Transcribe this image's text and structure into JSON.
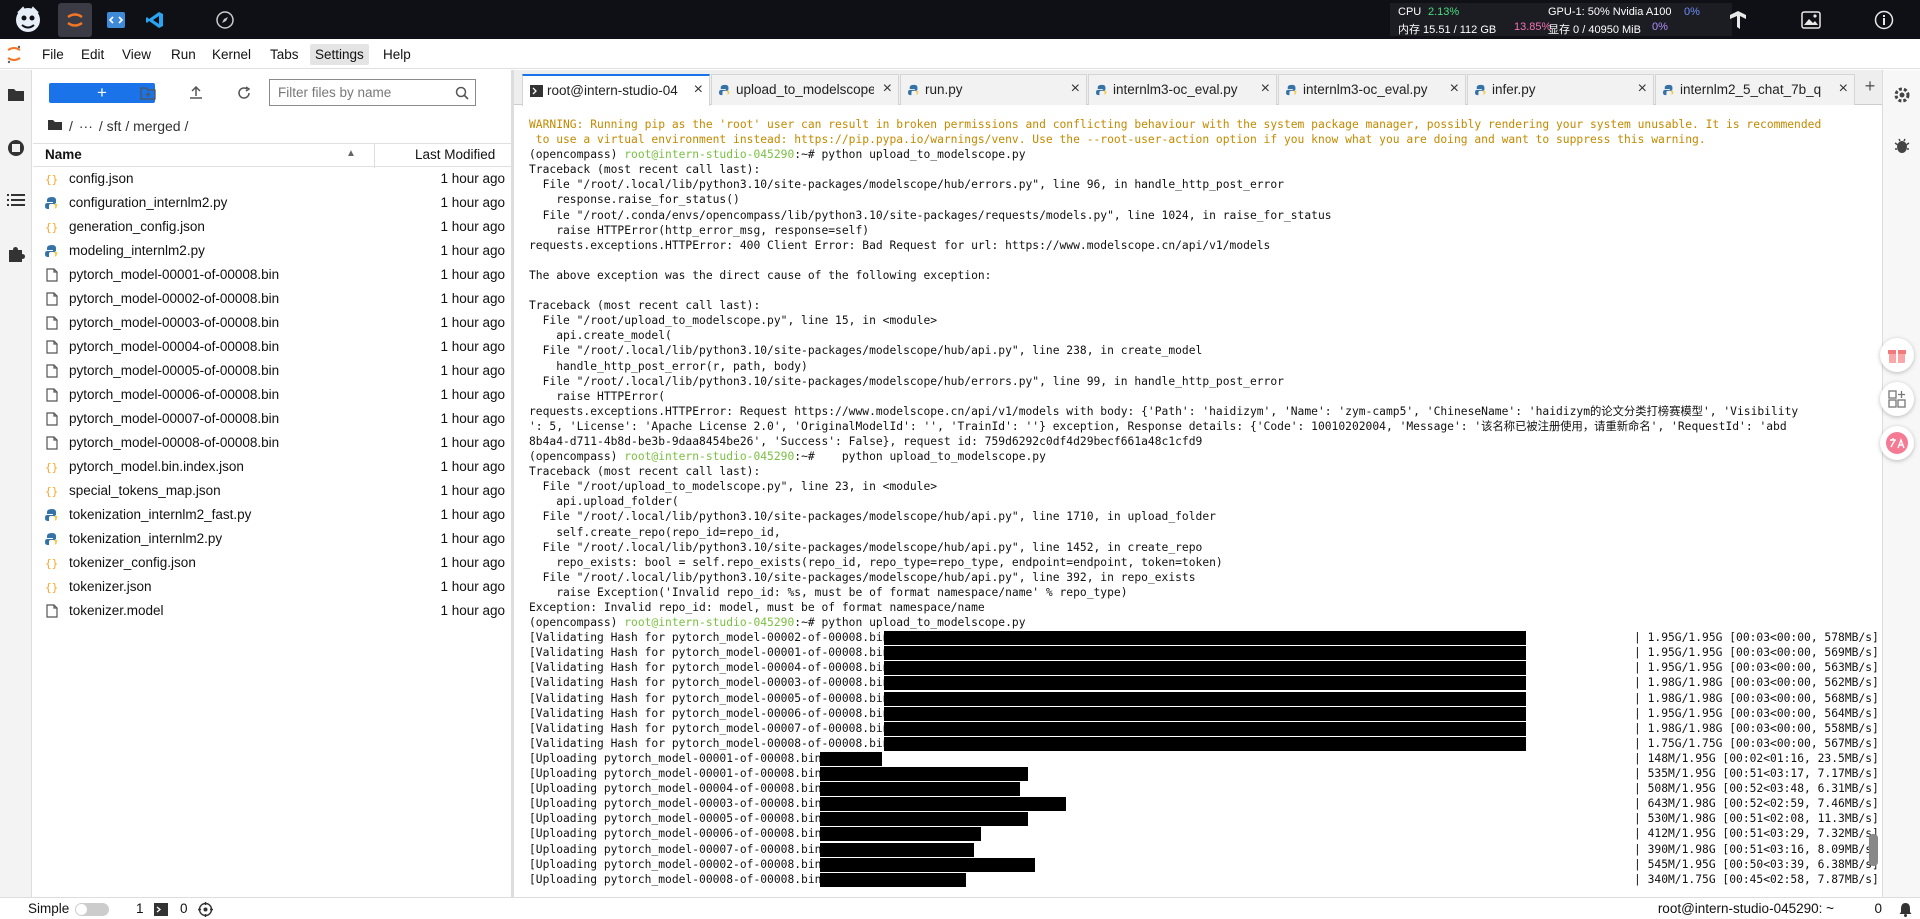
{
  "topbar": {
    "stats": {
      "cpu_label": "CPU",
      "cpu_value": "2.13%",
      "mem_label": "内存 15.51 / 112 GB",
      "mem_percent": "13.85%",
      "gpu_label": "GPU-1: 50% Nvidia A100",
      "gpu_percent": "0%",
      "vram_label": "显存 0 / 40950 MiB",
      "vram_percent": "0%"
    }
  },
  "menubar": [
    "File",
    "Edit",
    "View",
    "Run",
    "Kernel",
    "Tabs",
    "Settings",
    "Help"
  ],
  "filebrowser": {
    "filter_placeholder": "Filter files by name",
    "breadcrumb": [
      "/",
      "···",
      "/ sft / merged /"
    ],
    "col_name": "Name",
    "col_modified": "Last Modified",
    "files": [
      {
        "name": "config.json",
        "modified": "1 hour ago",
        "type": "json"
      },
      {
        "name": "configuration_internlm2.py",
        "modified": "1 hour ago",
        "type": "py"
      },
      {
        "name": "generation_config.json",
        "modified": "1 hour ago",
        "type": "json"
      },
      {
        "name": "modeling_internlm2.py",
        "modified": "1 hour ago",
        "type": "py"
      },
      {
        "name": "pytorch_model-00001-of-00008.bin",
        "modified": "1 hour ago",
        "type": "file"
      },
      {
        "name": "pytorch_model-00002-of-00008.bin",
        "modified": "1 hour ago",
        "type": "file"
      },
      {
        "name": "pytorch_model-00003-of-00008.bin",
        "modified": "1 hour ago",
        "type": "file"
      },
      {
        "name": "pytorch_model-00004-of-00008.bin",
        "modified": "1 hour ago",
        "type": "file"
      },
      {
        "name": "pytorch_model-00005-of-00008.bin",
        "modified": "1 hour ago",
        "type": "file"
      },
      {
        "name": "pytorch_model-00006-of-00008.bin",
        "modified": "1 hour ago",
        "type": "file"
      },
      {
        "name": "pytorch_model-00007-of-00008.bin",
        "modified": "1 hour ago",
        "type": "file"
      },
      {
        "name": "pytorch_model-00008-of-00008.bin",
        "modified": "1 hour ago",
        "type": "file"
      },
      {
        "name": "pytorch_model.bin.index.json",
        "modified": "1 hour ago",
        "type": "json"
      },
      {
        "name": "special_tokens_map.json",
        "modified": "1 hour ago",
        "type": "json"
      },
      {
        "name": "tokenization_internlm2_fast.py",
        "modified": "1 hour ago",
        "type": "py"
      },
      {
        "name": "tokenization_internlm2.py",
        "modified": "1 hour ago",
        "type": "py"
      },
      {
        "name": "tokenizer_config.json",
        "modified": "1 hour ago",
        "type": "json"
      },
      {
        "name": "tokenizer.json",
        "modified": "1 hour ago",
        "type": "json"
      },
      {
        "name": "tokenizer.model",
        "modified": "1 hour ago",
        "type": "file"
      }
    ]
  },
  "tabs": [
    {
      "label": "root@intern-studio-04",
      "kind": "terminal",
      "active": true
    },
    {
      "label": "upload_to_modelscope",
      "kind": "py",
      "active": false
    },
    {
      "label": "run.py",
      "kind": "py",
      "active": false
    },
    {
      "label": "internlm3-oc_eval.py",
      "kind": "py",
      "active": false
    },
    {
      "label": "internlm3-oc_eval.py",
      "kind": "py",
      "active": false
    },
    {
      "label": "infer.py",
      "kind": "py",
      "active": false
    },
    {
      "label": "internlm2_5_chat_7b_q",
      "kind": "py",
      "active": false
    }
  ],
  "terminal": {
    "lines": [
      {
        "style": "warn",
        "text": "WARNING: Running pip as the 'root' user can result in broken permissions and conflicting behaviour with the system package manager, possibly rendering your system unusable. It is recommended"
      },
      {
        "style": "warn",
        "text": " to use a virtual environment instead: https://pip.pypa.io/warnings/venv. Use the --root-user-action option if you know what you are doing and want to suppress this warning."
      },
      {
        "style": "prompt",
        "env": "(opencompass) ",
        "user": "root@intern-studio-045290",
        "text": ":~# python upload_to_modelscope.py"
      },
      {
        "style": "plain",
        "text": "Traceback (most recent call last):"
      },
      {
        "style": "plain",
        "text": "  File \"/root/.local/lib/python3.10/site-packages/modelscope/hub/errors.py\", line 96, in handle_http_post_error"
      },
      {
        "style": "plain",
        "text": "    response.raise_for_status()"
      },
      {
        "style": "plain",
        "text": "  File \"/root/.conda/envs/opencompass/lib/python3.10/site-packages/requests/models.py\", line 1024, in raise_for_status"
      },
      {
        "style": "plain",
        "text": "    raise HTTPError(http_error_msg, response=self)"
      },
      {
        "style": "plain",
        "text": "requests.exceptions.HTTPError: 400 Client Error: Bad Request for url: https://www.modelscope.cn/api/v1/models"
      },
      {
        "style": "plain",
        "text": ""
      },
      {
        "style": "plain",
        "text": "The above exception was the direct cause of the following exception:"
      },
      {
        "style": "plain",
        "text": ""
      },
      {
        "style": "plain",
        "text": "Traceback (most recent call last):"
      },
      {
        "style": "plain",
        "text": "  File \"/root/upload_to_modelscope.py\", line 15, in <module>"
      },
      {
        "style": "plain",
        "text": "    api.create_model("
      },
      {
        "style": "plain",
        "text": "  File \"/root/.local/lib/python3.10/site-packages/modelscope/hub/api.py\", line 238, in create_model"
      },
      {
        "style": "plain",
        "text": "    handle_http_post_error(r, path, body)"
      },
      {
        "style": "plain",
        "text": "  File \"/root/.local/lib/python3.10/site-packages/modelscope/hub/errors.py\", line 99, in handle_http_post_error"
      },
      {
        "style": "plain",
        "text": "    raise HTTPError("
      },
      {
        "style": "plain",
        "text": "requests.exceptions.HTTPError: Request https://www.modelscope.cn/api/v1/models with body: {'Path': 'haidizym', 'Name': 'zym-camp5', 'ChineseName': 'haidizym的论文分类打榜赛模型', 'Visibility"
      },
      {
        "style": "plain",
        "text": "': 5, 'License': 'Apache License 2.0', 'OriginalModelId': '', 'TrainId': ''} exception, Response details: {'Code': 10010202004, 'Message': '该名称已被注册使用，请重新命名', 'RequestId': 'abd"
      },
      {
        "style": "plain",
        "text": "8b4a4-d711-4b8d-be3b-9daa8454be26', 'Success': False}, request id: 759d6292c0df4d29becf661a48c1cfd9"
      },
      {
        "style": "prompt",
        "env": "(opencompass) ",
        "user": "root@intern-studio-045290",
        "text": ":~#    python upload_to_modelscope.py"
      },
      {
        "style": "plain",
        "text": "Traceback (most recent call last):"
      },
      {
        "style": "plain",
        "text": "  File \"/root/upload_to_modelscope.py\", line 23, in <module>"
      },
      {
        "style": "plain",
        "text": "    api.upload_folder("
      },
      {
        "style": "plain",
        "text": "  File \"/root/.local/lib/python3.10/site-packages/modelscope/hub/api.py\", line 1710, in upload_folder"
      },
      {
        "style": "plain",
        "text": "    self.create_repo(repo_id=repo_id,"
      },
      {
        "style": "plain",
        "text": "  File \"/root/.local/lib/python3.10/site-packages/modelscope/hub/api.py\", line 1452, in create_repo"
      },
      {
        "style": "plain",
        "text": "    repo_exists: bool = self.repo_exists(repo_id, repo_type=repo_type, endpoint=endpoint, token=token)"
      },
      {
        "style": "plain",
        "text": "  File \"/root/.local/lib/python3.10/site-packages/modelscope/hub/api.py\", line 392, in repo_exists"
      },
      {
        "style": "plain",
        "text": "    raise Exception('Invalid repo_id: %s, must be of format namespace/name' % repo_type)"
      },
      {
        "style": "plain",
        "text": "Exception: Invalid repo_id: model, must be of format namespace/name"
      },
      {
        "style": "prompt",
        "env": "(opencompass) ",
        "user": "root@intern-studio-045290",
        "text": ":~# python upload_to_modelscope.py"
      }
    ],
    "progress": [
      {
        "label": "[Validating Hash for pytorch_model-00002-of-00008.bin]: 100%|",
        "fraction": 1.0,
        "stats": "| 1.95G/1.95G [00:03<00:00, 578MB/s]"
      },
      {
        "label": "[Validating Hash for pytorch_model-00001-of-00008.bin]: 100%|",
        "fraction": 1.0,
        "stats": "| 1.95G/1.95G [00:03<00:00, 569MB/s]"
      },
      {
        "label": "[Validating Hash for pytorch_model-00004-of-00008.bin]: 100%|",
        "fraction": 1.0,
        "stats": "| 1.95G/1.95G [00:03<00:00, 563MB/s]"
      },
      {
        "label": "[Validating Hash for pytorch_model-00003-of-00008.bin]: 100%|",
        "fraction": 1.0,
        "stats": "| 1.98G/1.98G [00:03<00:00, 562MB/s]"
      },
      {
        "label": "[Validating Hash for pytorch_model-00005-of-00008.bin]: 100%|",
        "fraction": 1.0,
        "stats": "| 1.98G/1.98G [00:03<00:00, 568MB/s]"
      },
      {
        "label": "[Validating Hash for pytorch_model-00006-of-00008.bin]: 100%|",
        "fraction": 1.0,
        "stats": "| 1.95G/1.95G [00:03<00:00, 564MB/s]"
      },
      {
        "label": "[Validating Hash for pytorch_model-00007-of-00008.bin]: 100%|",
        "fraction": 1.0,
        "stats": "| 1.98G/1.98G [00:03<00:00, 558MB/s]"
      },
      {
        "label": "[Validating Hash for pytorch_model-00008-of-00008.bin]: 100%|",
        "fraction": 1.0,
        "stats": "| 1.75G/1.75G [00:03<00:00, 567MB/s]"
      },
      {
        "label": "[Uploading pytorch_model-00001-of-00008.bin]:   8%|",
        "fraction": 0.08,
        "stats": "| 148M/1.95G [00:02<01:16, 23.5MB/s]"
      },
      {
        "label": "[Uploading pytorch_model-00001-of-00008.bin]:  27%|",
        "fraction": 0.27,
        "stats": "| 535M/1.95G [00:51<03:17, 7.17MB/s]"
      },
      {
        "label": "[Uploading pytorch_model-00004-of-00008.bin]:  26%|",
        "fraction": 0.26,
        "stats": "| 508M/1.95G [00:52<03:48, 6.31MB/s]"
      },
      {
        "label": "[Uploading pytorch_model-00003-of-00008.bin]:  32%|",
        "fraction": 0.32,
        "stats": "| 643M/1.98G [00:52<02:59, 7.46MB/s]"
      },
      {
        "label": "[Uploading pytorch_model-00005-of-00008.bin]:  27%|",
        "fraction": 0.27,
        "stats": "| 530M/1.98G [00:51<02:08, 11.3MB/s]"
      },
      {
        "label": "[Uploading pytorch_model-00006-of-00008.bin]:  21%|",
        "fraction": 0.21,
        "stats": "| 412M/1.95G [00:51<03:29, 7.32MB/s]"
      },
      {
        "label": "[Uploading pytorch_model-00007-of-00008.bin]:  20%|",
        "fraction": 0.2,
        "stats": "| 390M/1.98G [00:51<03:16, 8.09MB/s]"
      },
      {
        "label": "[Uploading pytorch_model-00002-of-00008.bin]:  28%|",
        "fraction": 0.28,
        "stats": "| 545M/1.95G [00:50<03:39, 6.38MB/s]"
      },
      {
        "label": "[Uploading pytorch_model-00008-of-00008.bin]:  19%|",
        "fraction": 0.19,
        "stats": "| 340M/1.75G [00:45<02:58, 7.87MB/s]"
      }
    ]
  },
  "statusbar": {
    "mode": "Simple",
    "count_kernels": "1",
    "count_terminals": "0",
    "terminal_name": "root@intern-studio-045290: ~",
    "right_count": "0"
  },
  "colors": {
    "accent": "#1a73e8",
    "topbar": "#0f1015",
    "warning_text": "#c38a00",
    "prompt_user": "#7bc043"
  }
}
